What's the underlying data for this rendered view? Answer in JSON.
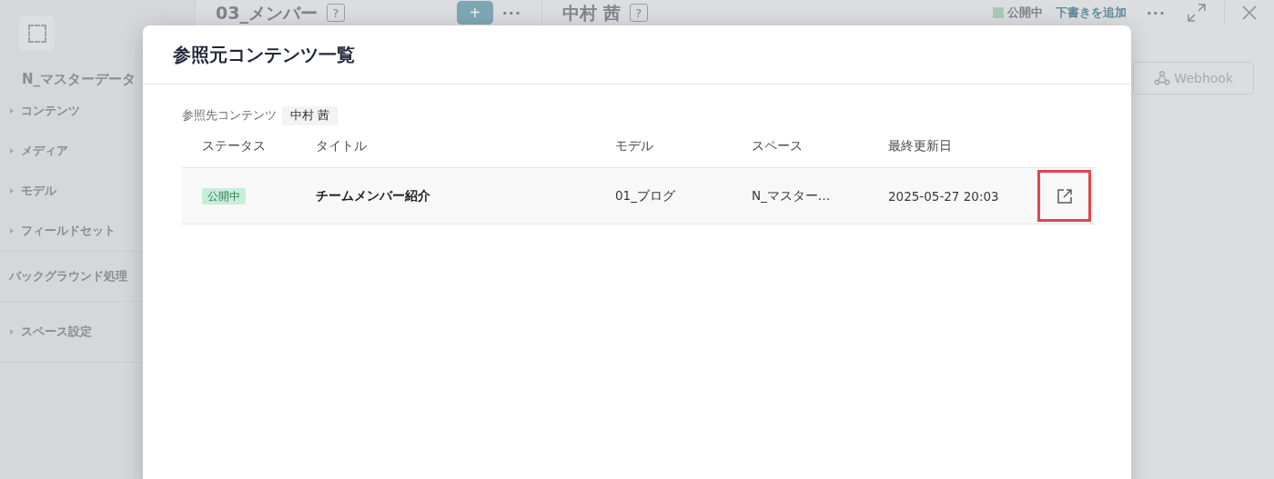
{
  "sidebar": {
    "space_name": "N_マスターデータ",
    "items": [
      {
        "label": "コンテンツ",
        "kind": "group"
      },
      {
        "label": "メディア",
        "kind": "group"
      },
      {
        "label": "モデル",
        "kind": "group"
      },
      {
        "label": "フィールドセット",
        "kind": "group"
      },
      {
        "label": "バックグラウンド処理",
        "kind": "section"
      },
      {
        "label": "スペース設定",
        "kind": "group"
      }
    ]
  },
  "list_panel": {
    "title": "03_メンバー",
    "help": "?",
    "add": "+",
    "more": "···"
  },
  "detail_panel": {
    "title": "中村 茜",
    "help": "?",
    "status": "公開中",
    "add_draft": "下書きを追加",
    "more": "···",
    "webhook": "Webhook"
  },
  "dialog": {
    "title": "参照元コンテンツ一覧",
    "reference_label": "参照先コンテンツ",
    "reference_value": "中村 茜",
    "columns": [
      "ステータス",
      "タイトル",
      "モデル",
      "スペース",
      "最終更新日"
    ],
    "rows": [
      {
        "status": "公開中",
        "title": "チームメンバー紹介",
        "model": "01_ブログ",
        "space": "N_マスター…",
        "updated": "2025-05-27 20:03",
        "action_highlighted": true
      }
    ]
  }
}
